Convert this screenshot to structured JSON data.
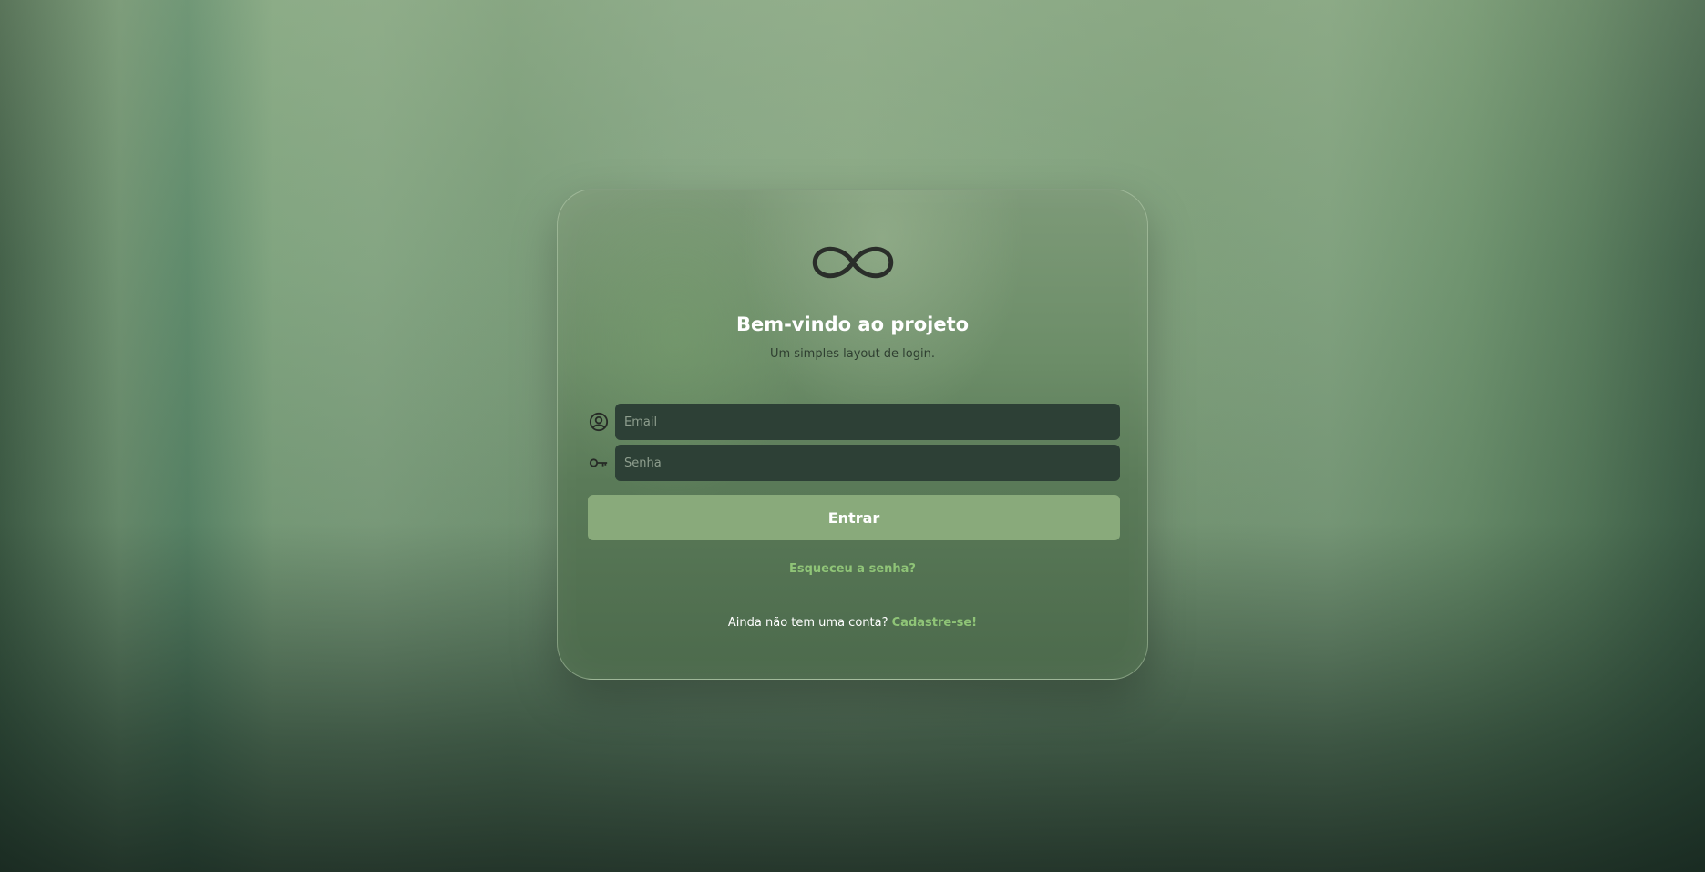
{
  "app": {
    "title": "Bem-vindo ao projeto",
    "subtitle": "Um simples layout de login."
  },
  "logo": {
    "icon": "infinity-icon"
  },
  "form": {
    "email": {
      "icon": "user-circle-icon",
      "placeholder": "Email",
      "value": ""
    },
    "password": {
      "icon": "key-icon",
      "placeholder": "Senha",
      "value": ""
    },
    "submit_label": "Entrar",
    "forgot_label": "Esqueceu a senha?"
  },
  "signup": {
    "prompt": "Ainda não tem uma conta?",
    "link_label": "Cadastre-se!"
  },
  "colors": {
    "accent": "#8fc477",
    "button": "#89aa7b",
    "input_bg": "#2d4036",
    "card_border": "#c8dcbe"
  }
}
